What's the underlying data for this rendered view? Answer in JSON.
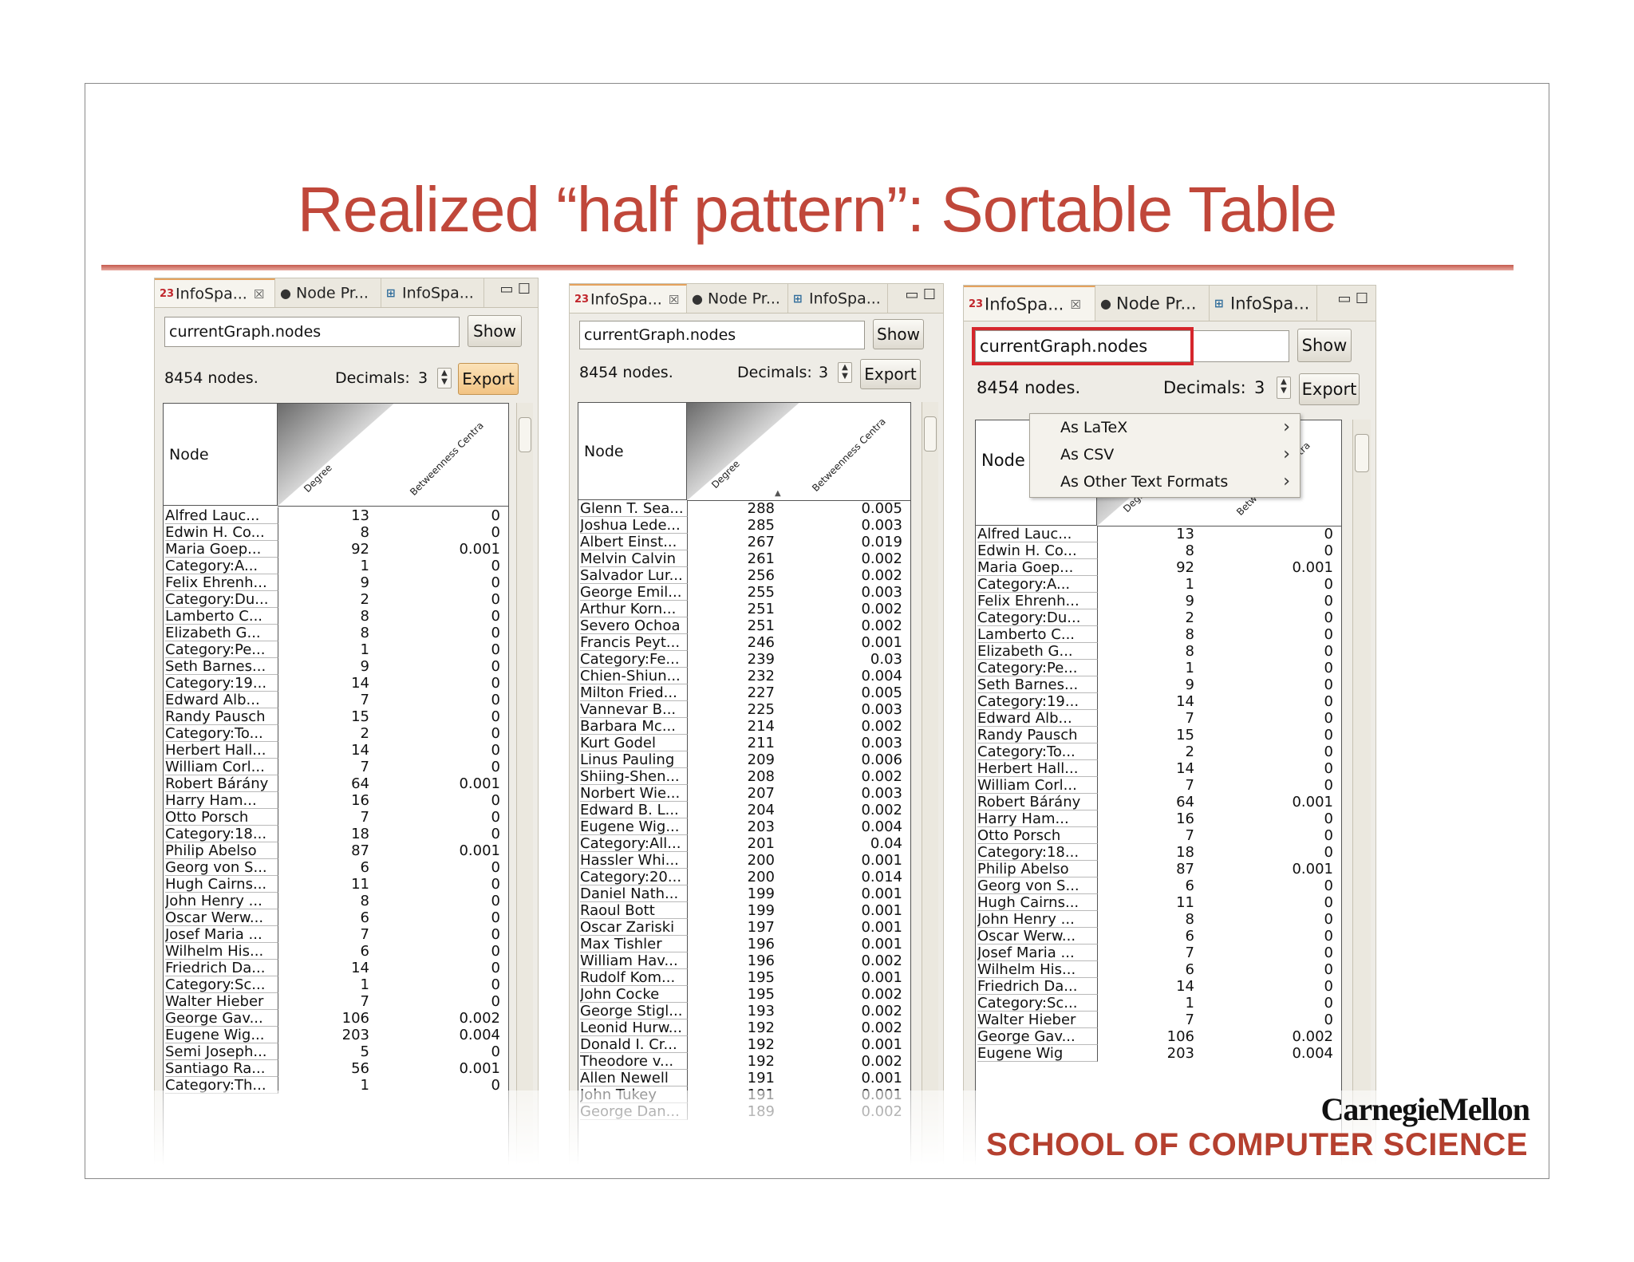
{
  "slide": {
    "title": "Realized “half pattern”: Sortable Table",
    "logo": "CarnegieMellon",
    "school": "SCHOOL OF COMPUTER SCIENCE"
  },
  "common": {
    "tabs": [
      "InfoSpa...",
      "Node Pr...",
      "InfoSpa..."
    ],
    "tab_close": "☒",
    "min_glyph": "▭",
    "max_glyph": "☐",
    "query_value": "currentGraph.nodes",
    "show_label": "Show",
    "nodes_count": "8454 nodes.",
    "decimals_label": "Decimals:",
    "decimals_value": "3",
    "export_label": "Export",
    "col_node": "Node",
    "col_degree": "Degree",
    "col_betweenness": "Betweenness Centra",
    "icons": {
      "infospace": "23",
      "node_props": "bug-icon",
      "tree": "tree-icon"
    }
  },
  "panels": [
    {
      "rows": [
        [
          "Alfred Lauc...",
          "13",
          "0"
        ],
        [
          "Edwin H. Co...",
          "8",
          "0"
        ],
        [
          "Maria Goep...",
          "92",
          "0.001"
        ],
        [
          "Category:A...",
          "1",
          "0"
        ],
        [
          "Felix Ehrenh...",
          "9",
          "0"
        ],
        [
          "Category:Du...",
          "2",
          "0"
        ],
        [
          "Lamberto C...",
          "8",
          "0"
        ],
        [
          "Elizabeth G...",
          "8",
          "0"
        ],
        [
          "Category:Pe...",
          "1",
          "0"
        ],
        [
          "Seth Barnes...",
          "9",
          "0"
        ],
        [
          "Category:19...",
          "14",
          "0"
        ],
        [
          "Edward Alb...",
          "7",
          "0"
        ],
        [
          "Randy Pausch",
          "15",
          "0"
        ],
        [
          "Category:To...",
          "2",
          "0"
        ],
        [
          "Herbert Hall...",
          "14",
          "0"
        ],
        [
          "William Corl...",
          "7",
          "0"
        ],
        [
          "Robert Bárány",
          "64",
          "0.001"
        ],
        [
          "Harry Ham...",
          "16",
          "0"
        ],
        [
          "Otto Porsch",
          "7",
          "0"
        ],
        [
          "Category:18...",
          "18",
          "0"
        ],
        [
          "Philip Abelso",
          "87",
          "0.001"
        ],
        [
          "Georg von S...",
          "6",
          "0"
        ],
        [
          "Hugh Cairns...",
          "11",
          "0"
        ],
        [
          "John Henry ...",
          "8",
          "0"
        ],
        [
          "Oscar Werw...",
          "6",
          "0"
        ],
        [
          "Josef Maria ...",
          "7",
          "0"
        ],
        [
          "Wilhelm His...",
          "6",
          "0"
        ],
        [
          "Friedrich Da...",
          "14",
          "0"
        ],
        [
          "Category:Sc...",
          "1",
          "0"
        ],
        [
          "Walter Hieber",
          "7",
          "0"
        ],
        [
          "George Gav...",
          "106",
          "0.002"
        ],
        [
          "Eugene Wig...",
          "203",
          "0.004"
        ],
        [
          "Semi Joseph...",
          "5",
          "0"
        ],
        [
          "Santiago Ra...",
          "56",
          "0.001"
        ],
        [
          "Category:Th...",
          "1",
          "0"
        ]
      ]
    },
    {
      "rows": [
        [
          "Glenn T. Sea...",
          "288",
          "0.005"
        ],
        [
          "Joshua Lede...",
          "285",
          "0.003"
        ],
        [
          "Albert Einst...",
          "267",
          "0.019"
        ],
        [
          "Melvin Calvin",
          "261",
          "0.002"
        ],
        [
          "Salvador Lur...",
          "256",
          "0.002"
        ],
        [
          "George Emil...",
          "255",
          "0.003"
        ],
        [
          "Arthur Korn...",
          "251",
          "0.002"
        ],
        [
          "Severo Ochoa",
          "251",
          "0.002"
        ],
        [
          "Francis Peyt...",
          "246",
          "0.001"
        ],
        [
          "Category:Fe...",
          "239",
          "0.03"
        ],
        [
          "Chien-Shiun...",
          "232",
          "0.004"
        ],
        [
          "Milton Fried...",
          "227",
          "0.005"
        ],
        [
          "Vannevar B...",
          "225",
          "0.003"
        ],
        [
          "Barbara Mc...",
          "214",
          "0.002"
        ],
        [
          "Kurt Godel",
          "211",
          "0.003"
        ],
        [
          "Linus Pauling",
          "209",
          "0.006"
        ],
        [
          "Shiing-Shen...",
          "208",
          "0.002"
        ],
        [
          "Norbert Wie...",
          "207",
          "0.003"
        ],
        [
          "Edward B. L...",
          "204",
          "0.002"
        ],
        [
          "Eugene Wig...",
          "203",
          "0.004"
        ],
        [
          "Category:All...",
          "201",
          "0.04"
        ],
        [
          "Hassler Whi...",
          "200",
          "0.001"
        ],
        [
          "Category:20...",
          "200",
          "0.014"
        ],
        [
          "Daniel Nath...",
          "199",
          "0.001"
        ],
        [
          "Raoul Bott",
          "199",
          "0.001"
        ],
        [
          "Oscar Zariski",
          "197",
          "0.001"
        ],
        [
          "Max Tishler",
          "196",
          "0.001"
        ],
        [
          "William Hav...",
          "196",
          "0.002"
        ],
        [
          "Rudolf Kom...",
          "195",
          "0.001"
        ],
        [
          "John Cocke",
          "195",
          "0.002"
        ],
        [
          "George Stigl...",
          "193",
          "0.002"
        ],
        [
          "Leonid Hurw...",
          "192",
          "0.002"
        ],
        [
          "Donald I. Cr...",
          "192",
          "0.001"
        ],
        [
          "Theodore v...",
          "192",
          "0.002"
        ],
        [
          "Allen Newell",
          "191",
          "0.001"
        ],
        [
          "John Tukey",
          "191",
          "0.001"
        ],
        [
          "George Dan...",
          "189",
          "0.002"
        ]
      ]
    },
    {
      "rows": [
        [
          "Alfred Lauc...",
          "13",
          "0"
        ],
        [
          "Edwin H. Co...",
          "8",
          "0"
        ],
        [
          "Maria Goep...",
          "92",
          "0.001"
        ],
        [
          "Category:A...",
          "1",
          "0"
        ],
        [
          "Felix Ehrenh...",
          "9",
          "0"
        ],
        [
          "Category:Du...",
          "2",
          "0"
        ],
        [
          "Lamberto C...",
          "8",
          "0"
        ],
        [
          "Elizabeth G...",
          "8",
          "0"
        ],
        [
          "Category:Pe...",
          "1",
          "0"
        ],
        [
          "Seth Barnes...",
          "9",
          "0"
        ],
        [
          "Category:19...",
          "14",
          "0"
        ],
        [
          "Edward Alb...",
          "7",
          "0"
        ],
        [
          "Randy Pausch",
          "15",
          "0"
        ],
        [
          "Category:To...",
          "2",
          "0"
        ],
        [
          "Herbert Hall...",
          "14",
          "0"
        ],
        [
          "William Corl...",
          "7",
          "0"
        ],
        [
          "Robert Bárány",
          "64",
          "0.001"
        ],
        [
          "Harry Ham...",
          "16",
          "0"
        ],
        [
          "Otto Porsch",
          "7",
          "0"
        ],
        [
          "Category:18...",
          "18",
          "0"
        ],
        [
          "Philip Abelso",
          "87",
          "0.001"
        ],
        [
          "Georg von S...",
          "6",
          "0"
        ],
        [
          "Hugh Cairns...",
          "11",
          "0"
        ],
        [
          "John Henry ...",
          "8",
          "0"
        ],
        [
          "Oscar Werw...",
          "6",
          "0"
        ],
        [
          "Josef Maria ...",
          "7",
          "0"
        ],
        [
          "Wilhelm His...",
          "6",
          "0"
        ],
        [
          "Friedrich Da...",
          "14",
          "0"
        ],
        [
          "Category:Sc...",
          "1",
          "0"
        ],
        [
          "Walter Hieber",
          "7",
          "0"
        ],
        [
          "George Gav...",
          "106",
          "0.002"
        ],
        [
          "Eugene Wig",
          "203",
          "0.004"
        ]
      ],
      "menu": [
        "As LaTeX",
        "As CSV",
        "As Other Text Formats"
      ]
    }
  ]
}
